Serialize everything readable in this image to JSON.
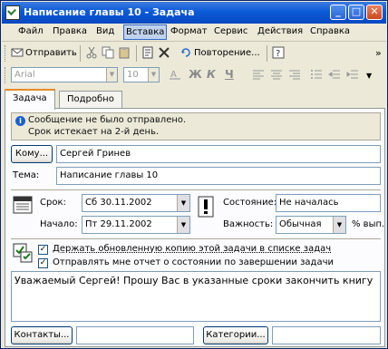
{
  "window": {
    "title": "Написание главы 10 - Задача",
    "buttons": {
      "minimize": "_",
      "maximize": "□",
      "close": "✕"
    }
  },
  "menu": {
    "items": [
      "Файл",
      "Правка",
      "Вид",
      "Вставка",
      "Формат",
      "Сервис",
      "Действия",
      "Справка"
    ],
    "active_index": 3
  },
  "toolbar": {
    "send_label": "Отправить",
    "recurrence_label": "Повторение...",
    "more_glyph": "»"
  },
  "format_bar": {
    "font": "Arial",
    "size": "10",
    "bold": "Ж",
    "italic": "К",
    "underline": "Ч"
  },
  "tabs": [
    {
      "label": "Задача",
      "active": true
    },
    {
      "label": "Подробно",
      "active": false
    }
  ],
  "info": {
    "line1": "Сообщение не было отправлено.",
    "line2": "Срок истекает на 2-й день."
  },
  "form": {
    "to_button": "Кому...",
    "to_value": "Сергей Гринев",
    "subject_label": "Тема:",
    "subject_value": "Написание главы 10",
    "due_label": "Срок:",
    "due_value": "Сб 30.11.2002",
    "start_label": "Начало:",
    "start_value": "Пт 29.11.2002",
    "status_label": "Состояние:",
    "status_value": "Не началась",
    "priority_label": "Важность:",
    "priority_value": "Обычная",
    "percent_label": "% вып."
  },
  "options": {
    "keep_copy_label": "Держать обновленную копию этой задачи в списке задач",
    "keep_copy_checked": true,
    "send_report_label": "Отправлять мне отчет о состоянии по завершении задачи",
    "send_report_checked": true
  },
  "body_text": "Уважаемый Сергей! Прошу Вас в указанные сроки закончить книгу",
  "footer": {
    "contacts_button": "Контакты...",
    "contacts_value": "",
    "categories_button": "Категории...",
    "categories_value": ""
  }
}
